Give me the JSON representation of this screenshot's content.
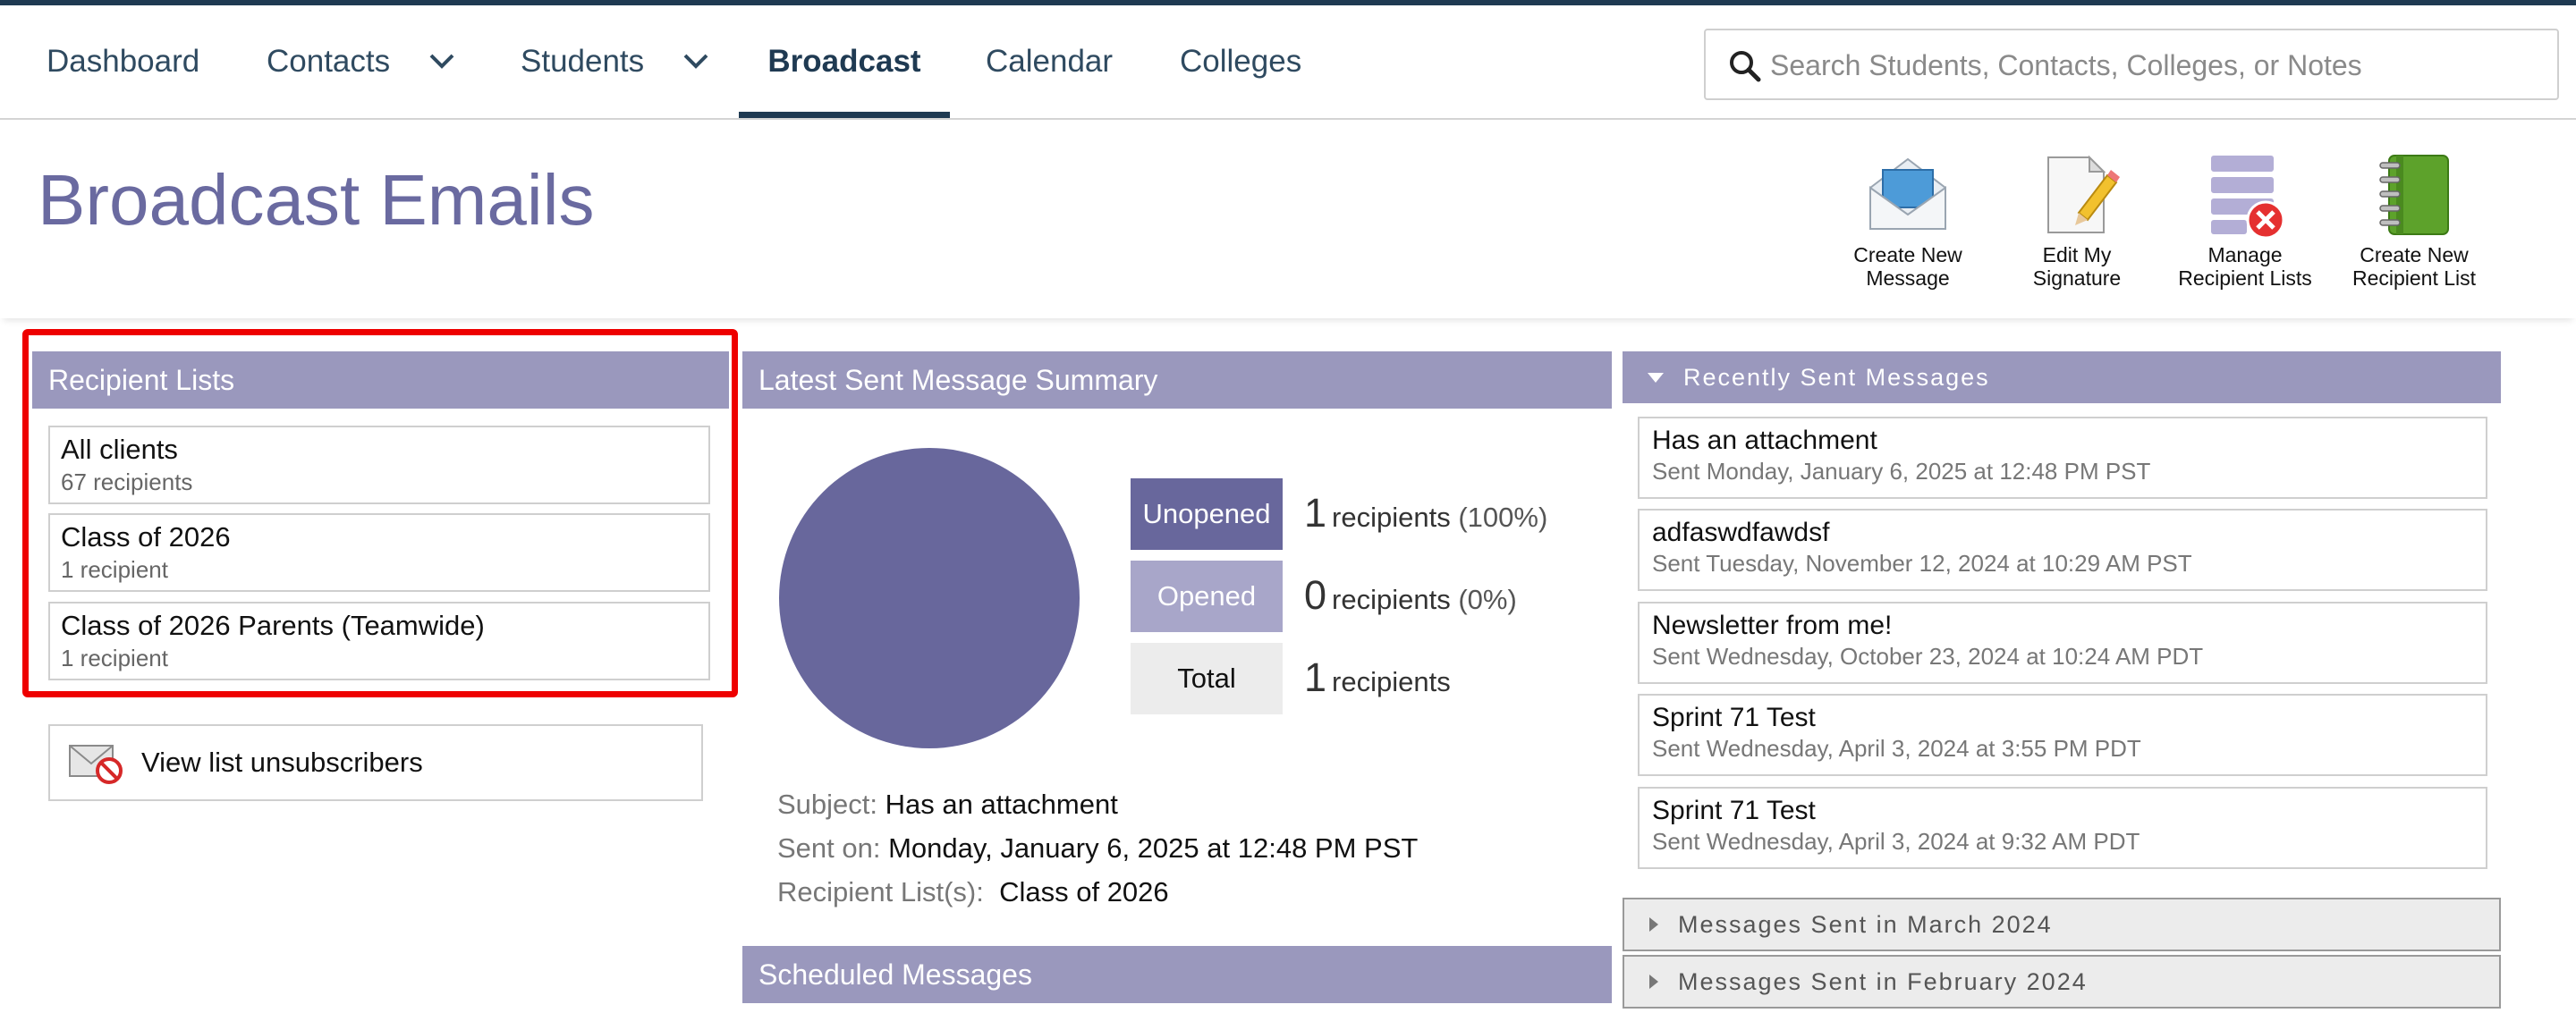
{
  "nav": {
    "items": [
      {
        "label": "Dashboard"
      },
      {
        "label": "Contacts"
      },
      {
        "label": "Students"
      },
      {
        "label": "Broadcast"
      },
      {
        "label": "Calendar"
      },
      {
        "label": "Colleges"
      }
    ],
    "active": "Broadcast",
    "search_placeholder": "Search Students, Contacts, Colleges, or Notes"
  },
  "page": {
    "title": "Broadcast Emails",
    "toolbar": [
      {
        "label": "Create New\nMessage",
        "icon": "envelope-icon"
      },
      {
        "label": "Edit My\nSignature",
        "icon": "pencil-document-icon"
      },
      {
        "label": "Manage\nRecipient Lists",
        "icon": "list-remove-icon"
      },
      {
        "label": "Create New\nRecipient List",
        "icon": "notebook-icon"
      }
    ]
  },
  "recipient_lists": {
    "header": "Recipient Lists",
    "items": [
      {
        "name": "All clients",
        "count": "67 recipients"
      },
      {
        "name": "Class of 2026",
        "count": "1 recipient"
      },
      {
        "name": "Class of 2026 Parents (Teamwide)",
        "count": "1 recipient"
      }
    ],
    "unsubscribers_label": "View list unsubscribers"
  },
  "summary": {
    "header": "Latest Sent Message Summary",
    "stats": [
      {
        "label": "Unopened",
        "value": "1",
        "unit": "recipients",
        "pct": "(100%)"
      },
      {
        "label": "Opened",
        "value": "0",
        "unit": "recipients",
        "pct": "(0%)"
      },
      {
        "label": "Total",
        "value": "1",
        "unit": "recipients",
        "pct": ""
      }
    ],
    "subject_label": "Subject:",
    "subject": "Has an attachment",
    "sent_label": "Sent on:",
    "sent": "Monday, January 6, 2025 at 12:48 PM PST",
    "lists_label": "Recipient List(s):",
    "lists": "Class of 2026",
    "pie_unopened_fraction": 1.0
  },
  "scheduled": {
    "header": "Scheduled Messages"
  },
  "recent": {
    "header": "Recently Sent Messages",
    "items": [
      {
        "title": "Has an attachment",
        "sent": "Sent Monday, January 6, 2025 at 12:48 PM PST"
      },
      {
        "title": "adfaswdfawdsf",
        "sent": "Sent Tuesday, November 12, 2024 at 10:29 AM PST"
      },
      {
        "title": "Newsletter from me!",
        "sent": "Sent Wednesday, October 23, 2024 at 10:24 AM PDT"
      },
      {
        "title": "Sprint 71 Test",
        "sent": "Sent Wednesday, April 3, 2024 at 3:55 PM PDT"
      },
      {
        "title": "Sprint 71 Test",
        "sent": "Sent Wednesday, April 3, 2024 at 9:32 AM PDT"
      }
    ],
    "groups": [
      {
        "label": "Messages Sent in March 2024"
      },
      {
        "label": "Messages Sent in February 2024"
      }
    ]
  },
  "colors": {
    "primary": "#1f3a52",
    "title": "#6a6aa0",
    "panel_header": "#9a98bd",
    "unopened": "#68679c",
    "opened": "#a8a6c9",
    "total": "#ececec",
    "highlight": "#ee0000"
  }
}
